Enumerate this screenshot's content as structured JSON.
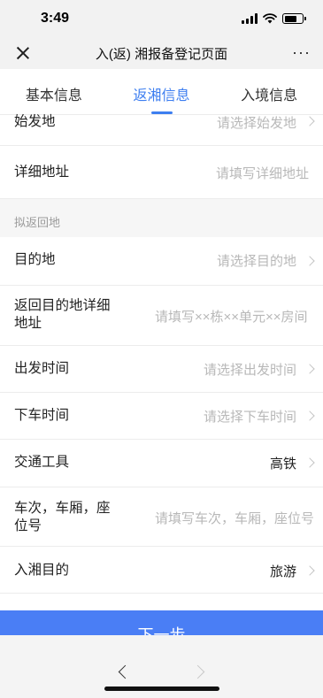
{
  "status": {
    "time": "3:49"
  },
  "nav": {
    "title": "入(返) 湘报备登记页面",
    "more": "···"
  },
  "tabs": [
    {
      "label": "基本信息"
    },
    {
      "label": "返湘信息"
    },
    {
      "label": "入境信息"
    }
  ],
  "form": {
    "origin": {
      "label": "始发地",
      "placeholder": "请选择始发地"
    },
    "detail_address": {
      "label": "详细地址",
      "placeholder": "请填写详细地址"
    },
    "section_label": "拟返回地",
    "destination": {
      "label": "目的地",
      "placeholder": "请选择目的地"
    },
    "dest_detail": {
      "label_line1": "返回目的地详细",
      "label_line2": "地址",
      "placeholder": "请填写××栋××单元××房间"
    },
    "depart_time": {
      "label": "出发时间",
      "placeholder": "请选择出发时间"
    },
    "arrive_time": {
      "label": "下车时间",
      "placeholder": "请选择下车时间"
    },
    "transport": {
      "label": "交通工具",
      "value": "高铁"
    },
    "seat": {
      "label_line1": "车次，车厢，座",
      "label_line2": "位号",
      "placeholder": "请填写车次，车厢，座位号"
    },
    "purpose": {
      "label": "入湘目的",
      "value": "旅游"
    }
  },
  "buttons": {
    "next": "下一步"
  }
}
